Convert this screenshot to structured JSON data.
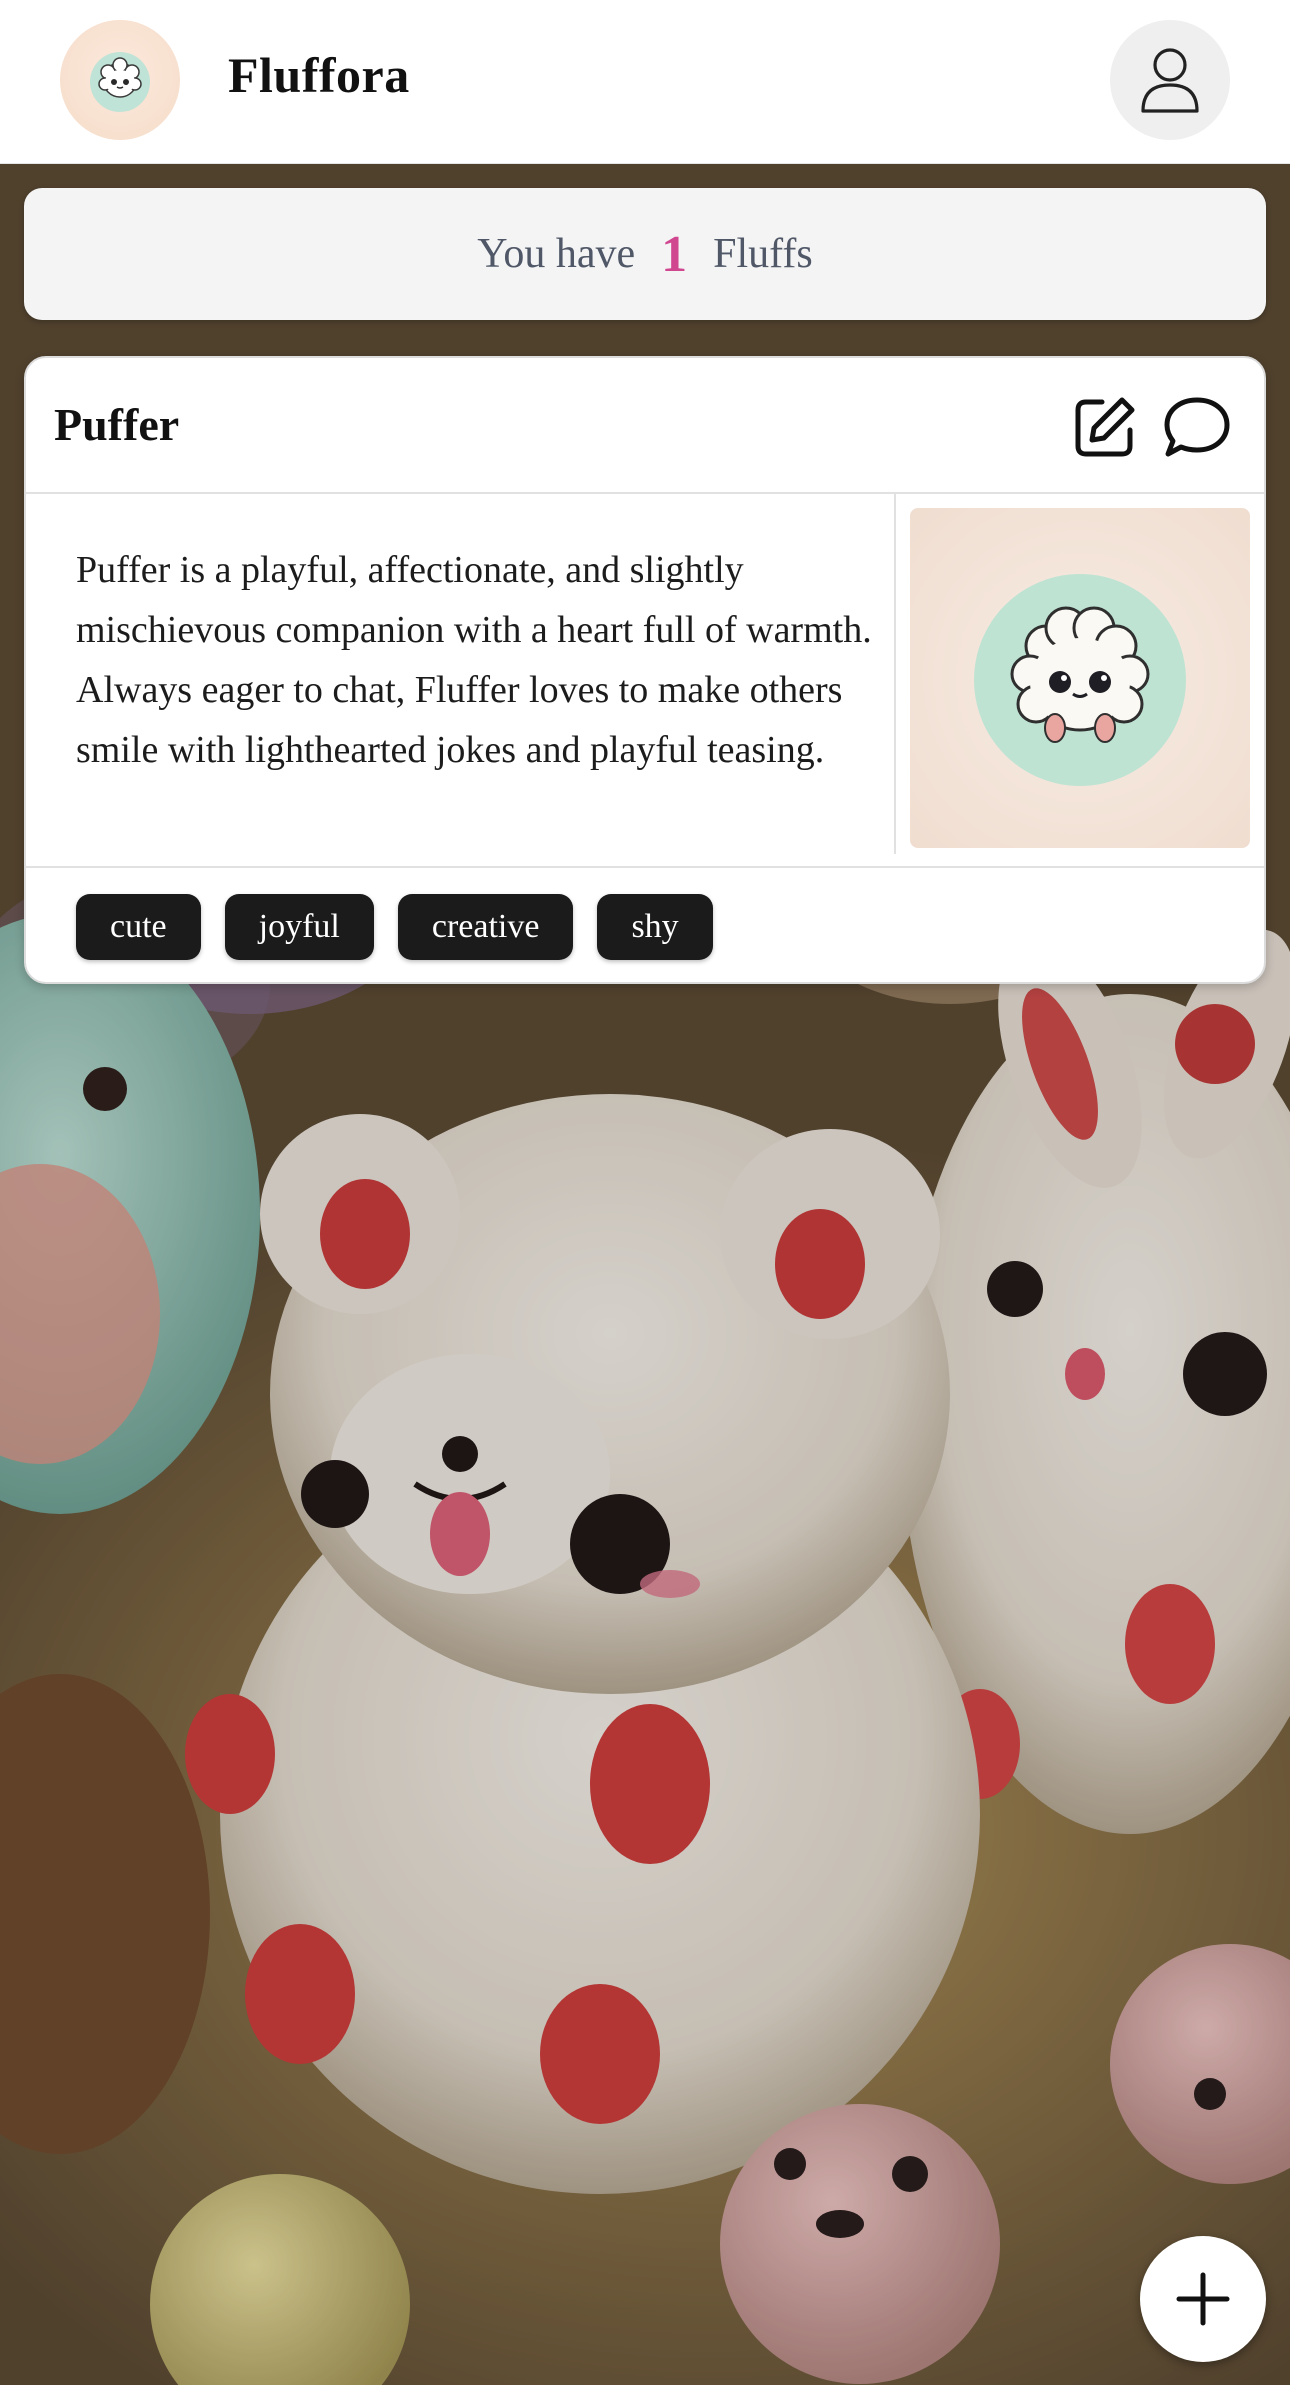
{
  "header": {
    "app_title": "Fluffora",
    "logo_icon": "fluff-mascot-icon",
    "profile_icon": "user-icon"
  },
  "count_banner": {
    "prefix": "You have",
    "count": "1",
    "suffix": "Fluffs",
    "count_color": "#d1478f"
  },
  "fluffs": [
    {
      "name": "Puffer",
      "description": "Puffer is a playful, affectionate, and slightly mischievous companion with a heart full of warmth. Always eager to chat, Fluffer loves to make others smile with lighthearted jokes and playful teasing.",
      "tags": [
        "cute",
        "joyful",
        "creative",
        "shy"
      ],
      "edit_icon": "edit-icon",
      "chat_icon": "chat-bubble-icon",
      "image_icon": "fluff-avatar-icon"
    }
  ],
  "fab": {
    "icon": "plus-icon"
  },
  "colors": {
    "tag_bg": "#1b1b1b",
    "banner_bg": "#f4f4f5",
    "card_bg": "#ffffff"
  }
}
